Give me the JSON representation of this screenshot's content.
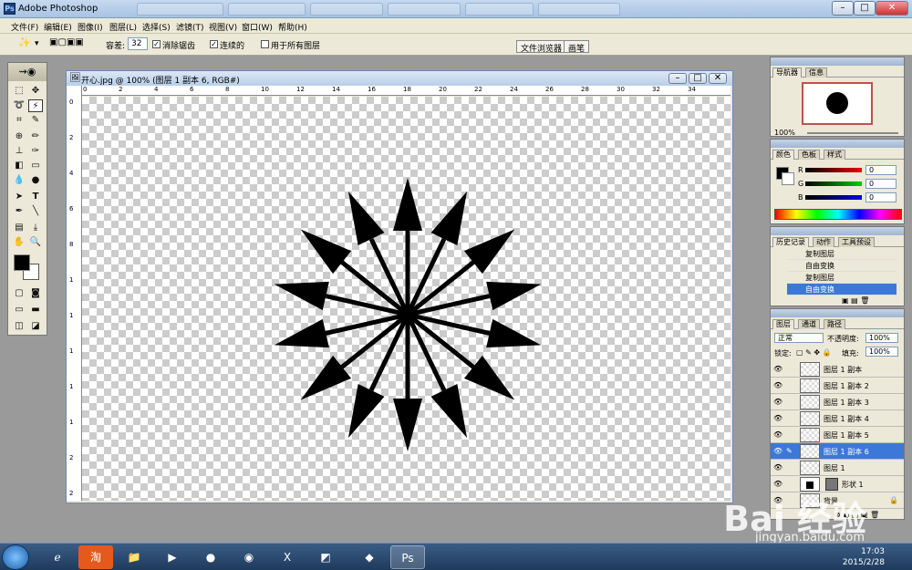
{
  "app": {
    "title": "Adobe Photoshop"
  },
  "menubar": {
    "items": [
      "文件(F)",
      "编辑(E)",
      "图像(I)",
      "图层(L)",
      "选择(S)",
      "滤镜(T)",
      "视图(V)",
      "窗口(W)",
      "帮助(H)"
    ]
  },
  "options": {
    "tolerance_label": "容差:",
    "tolerance_value": "32",
    "antialias_label": "消除锯齿",
    "contiguous_label": "连续的",
    "all_layers_label": "用于所有图层",
    "file_browser_tab": "文件浏览器",
    "brushes_tab": "画笔"
  },
  "document": {
    "title": "开心.jpg @ 100% (图层 1 副本 6, RGB#)",
    "ruler_h": [
      "0",
      "2",
      "4",
      "6",
      "8",
      "10",
      "12",
      "14",
      "16",
      "18",
      "20",
      "22",
      "24",
      "26",
      "28",
      "30",
      "32",
      "34"
    ],
    "ruler_v": [
      "0",
      "2",
      "4",
      "6",
      "8",
      "1",
      "1",
      "1",
      "1",
      "1",
      "2",
      "2"
    ]
  },
  "navigator": {
    "tabs": [
      "导航器",
      "信息"
    ],
    "zoom": "100%"
  },
  "color_panel": {
    "tabs": [
      "颜色",
      "色板",
      "样式"
    ],
    "channels": [
      {
        "label": "R",
        "value": "0"
      },
      {
        "label": "G",
        "value": "0"
      },
      {
        "label": "B",
        "value": "0"
      }
    ]
  },
  "history": {
    "tabs": [
      "历史记录",
      "动作",
      "工具预设"
    ],
    "items": [
      "复制图层",
      "自由变换",
      "复制图层",
      "自由变换"
    ]
  },
  "layers": {
    "tabs": [
      "图层",
      "通道",
      "路径"
    ],
    "blend_mode": "正常",
    "opacity_label": "不透明度:",
    "opacity_value": "100%",
    "lock_label": "锁定:",
    "fill_label": "填充:",
    "fill_value": "100%",
    "items": [
      {
        "name": "图层 1 副本"
      },
      {
        "name": "图层 1 副本 2"
      },
      {
        "name": "图层 1 副本 3"
      },
      {
        "name": "图层 1 副本 4"
      },
      {
        "name": "图层 1 副本 5"
      },
      {
        "name": "图层 1 副本 6"
      },
      {
        "name": "图层 1"
      },
      {
        "name": "形状 1"
      },
      {
        "name": "背景"
      }
    ]
  },
  "taskbar": {
    "time": "17:03",
    "date": "2015/2/28"
  },
  "watermark": {
    "main": "Bai 经验",
    "url": "jingyan.baidu.com"
  },
  "colors": {
    "accent": "#3c78d8",
    "shape": "#000000"
  }
}
